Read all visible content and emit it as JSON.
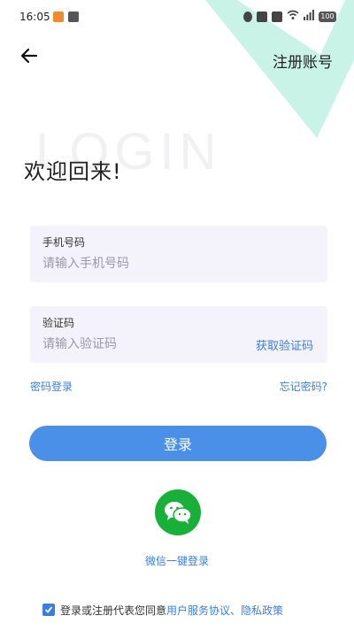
{
  "status_bar": {
    "time": "16:05",
    "icons": [
      "app-notification-icon",
      "app-notification-icon",
      "vibrate-icon",
      "screen-icon",
      "sim-icon",
      "wifi-icon",
      "signal-icon",
      "battery-icon"
    ],
    "battery_level": "100"
  },
  "header": {
    "back_icon": "arrow-left-icon",
    "register_label": "注册账号"
  },
  "watermark": "LOGIN",
  "title": "欢迎回来!",
  "phone_field": {
    "label": "手机号码",
    "placeholder": "请输入手机号码"
  },
  "code_field": {
    "label": "验证码",
    "placeholder": "请输入验证码",
    "get_code_label": "获取验证码"
  },
  "links": {
    "password_login": "密码登录",
    "forgot_password": "忘记密码?"
  },
  "login_button_label": "登录",
  "wechat": {
    "icon": "wechat-icon",
    "label": "微信一键登录"
  },
  "agreement": {
    "checked": true,
    "prefix": "登录或注册代表您同意",
    "terms_label": "用户服务协议",
    "separator": "、",
    "privacy_label": "隐私政策"
  },
  "colors": {
    "accent": "#3a7fe0",
    "button": "#4a90e8",
    "wechat": "#19b03a",
    "decor": "#b8efe0",
    "field_bg": "#f4f2fa"
  }
}
